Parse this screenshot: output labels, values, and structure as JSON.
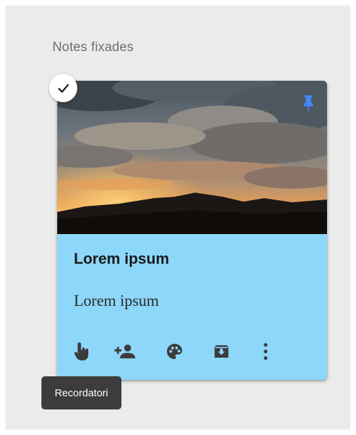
{
  "section": {
    "label": "Notes fixades"
  },
  "note": {
    "title": "Lorem ipsum",
    "body": "Lorem ipsum",
    "color": "#8cd7fa",
    "image": "sunset-clouds-over-mountains",
    "pinned": true,
    "selected": true
  },
  "toolbar": {
    "buttons": [
      {
        "icon": "reminder-hand-icon"
      },
      {
        "icon": "collaborator-icon"
      },
      {
        "icon": "palette-icon"
      },
      {
        "icon": "archive-icon"
      },
      {
        "icon": "more-vert-icon"
      }
    ]
  },
  "tooltip": {
    "text": "Recordatori"
  },
  "colors": {
    "background": "#ebebeb",
    "pin": "#4285f4",
    "icon": "#3c3c3c",
    "tooltip": "#3c3c3c"
  }
}
